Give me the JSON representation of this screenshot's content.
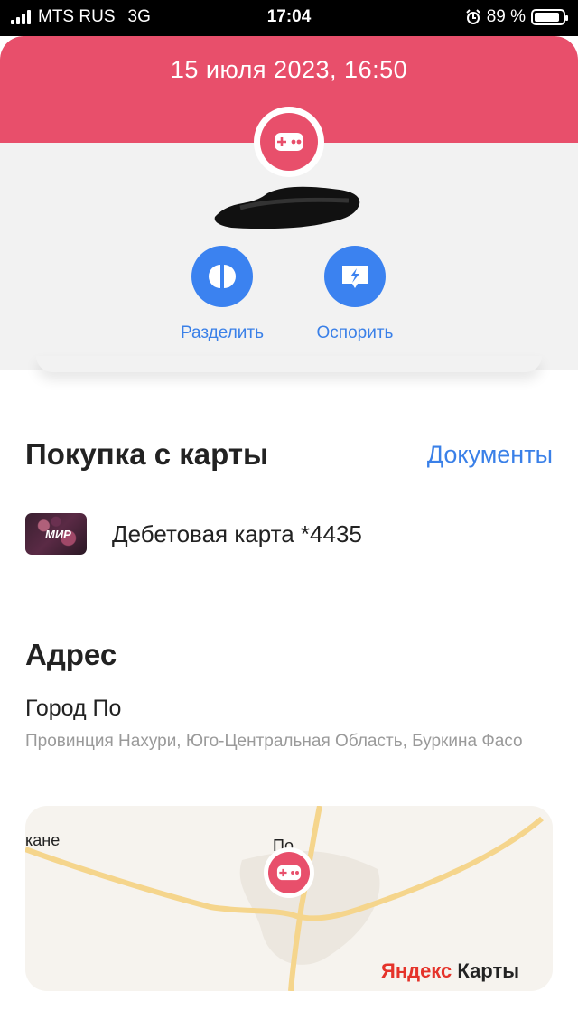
{
  "status_bar": {
    "carrier": "MTS RUS",
    "network": "3G",
    "time": "17:04",
    "battery": "89 %",
    "battery_level": 0.89
  },
  "header": {
    "date": "15 июля 2023, 16:50",
    "merchant_icon": "gamepad-icon",
    "accent_color": "#e84f6b"
  },
  "actions": [
    {
      "label": "Разделить",
      "icon": "split-icon"
    },
    {
      "label": "Оспорить",
      "icon": "dispute-icon"
    }
  ],
  "purchase": {
    "title": "Покупка с карты",
    "documents_link": "Документы",
    "card_brand": "МИР",
    "card_label": "Дебетовая карта *4435"
  },
  "address": {
    "title": "Адрес",
    "city": "Город По",
    "details": "Провинция Нахури, Юго-Центральная Область, Буркина Фасо"
  },
  "map": {
    "label_left": "кане",
    "label_top": "По",
    "brand_ya": "Яндекс",
    "brand_rest": " Карты"
  },
  "colors": {
    "link": "#3a80e8",
    "action_bg": "#3b82f0"
  }
}
